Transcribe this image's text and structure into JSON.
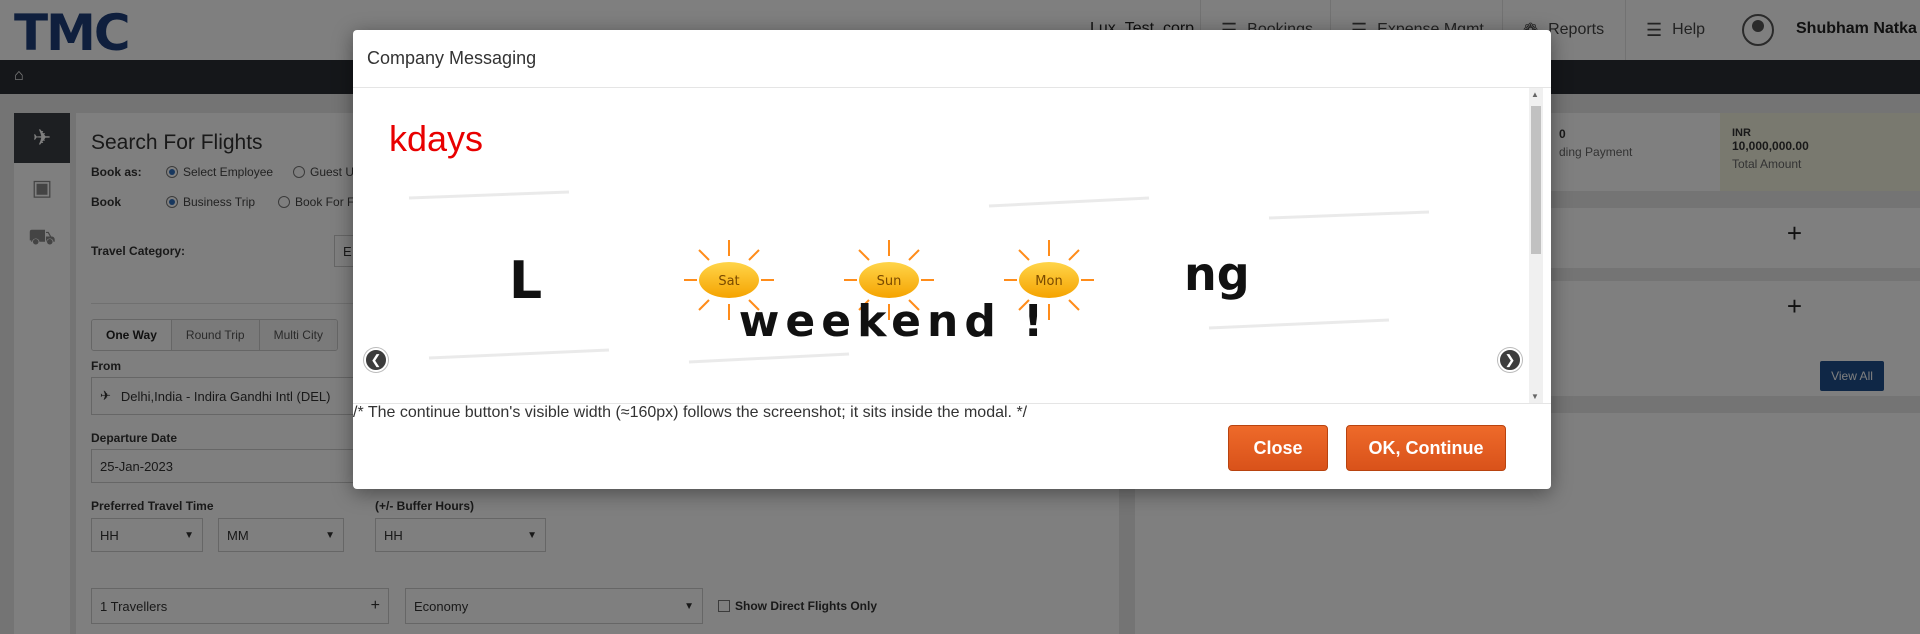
{
  "header": {
    "logo": "TMC",
    "corp": "Lux_Test_corp",
    "nav": [
      {
        "label": "Bookings",
        "icon": "list-icon"
      },
      {
        "label": "Expense Mgmt",
        "icon": "list-icon"
      },
      {
        "label": "Reports",
        "icon": "chart-icon"
      },
      {
        "label": "Help",
        "icon": "list-icon"
      }
    ],
    "user": "Shubham Natka"
  },
  "search": {
    "title": "Search For Flights",
    "book_as_label": "Book as:",
    "book_as_options": [
      "Select Employee",
      "Guest U"
    ],
    "book_label": "Book",
    "book_options": [
      "Business Trip",
      "Book For F"
    ],
    "travel_category_label": "Travel Category:",
    "travel_category_value": "E",
    "trip_types": [
      "One Way",
      "Round Trip",
      "Multi City"
    ],
    "from_label": "From",
    "from_value": "Delhi,India - Indira Gandhi Intl (DEL)",
    "departure_label": "Departure Date",
    "departure_value": "25-Jan-2023",
    "pref_time_label": "Preferred Travel Time",
    "hh": "HH",
    "mm": "MM",
    "buffer_label": "(+/- Buffer Hours)",
    "buffer_value": "HH",
    "travellers": "1 Travellers",
    "cabin": "Economy",
    "direct_only": "Show Direct Flights Only"
  },
  "summary": {
    "pending_value": "0",
    "pending_label": "ding Payment",
    "currency": "INR",
    "total_value": "10,000,000.00",
    "total_label": "Total Amount",
    "view_all": "View All"
  },
  "modal": {
    "title": "Company Messaging",
    "message_title": "kdays",
    "banner_top_left": "L",
    "banner_top_right": "ng",
    "banner_days": [
      "Sat",
      "Sun",
      "Mon"
    ],
    "banner_bottom": "weekend !",
    "close_label": "Close",
    "ok_label": "OK, Continue"
  }
}
